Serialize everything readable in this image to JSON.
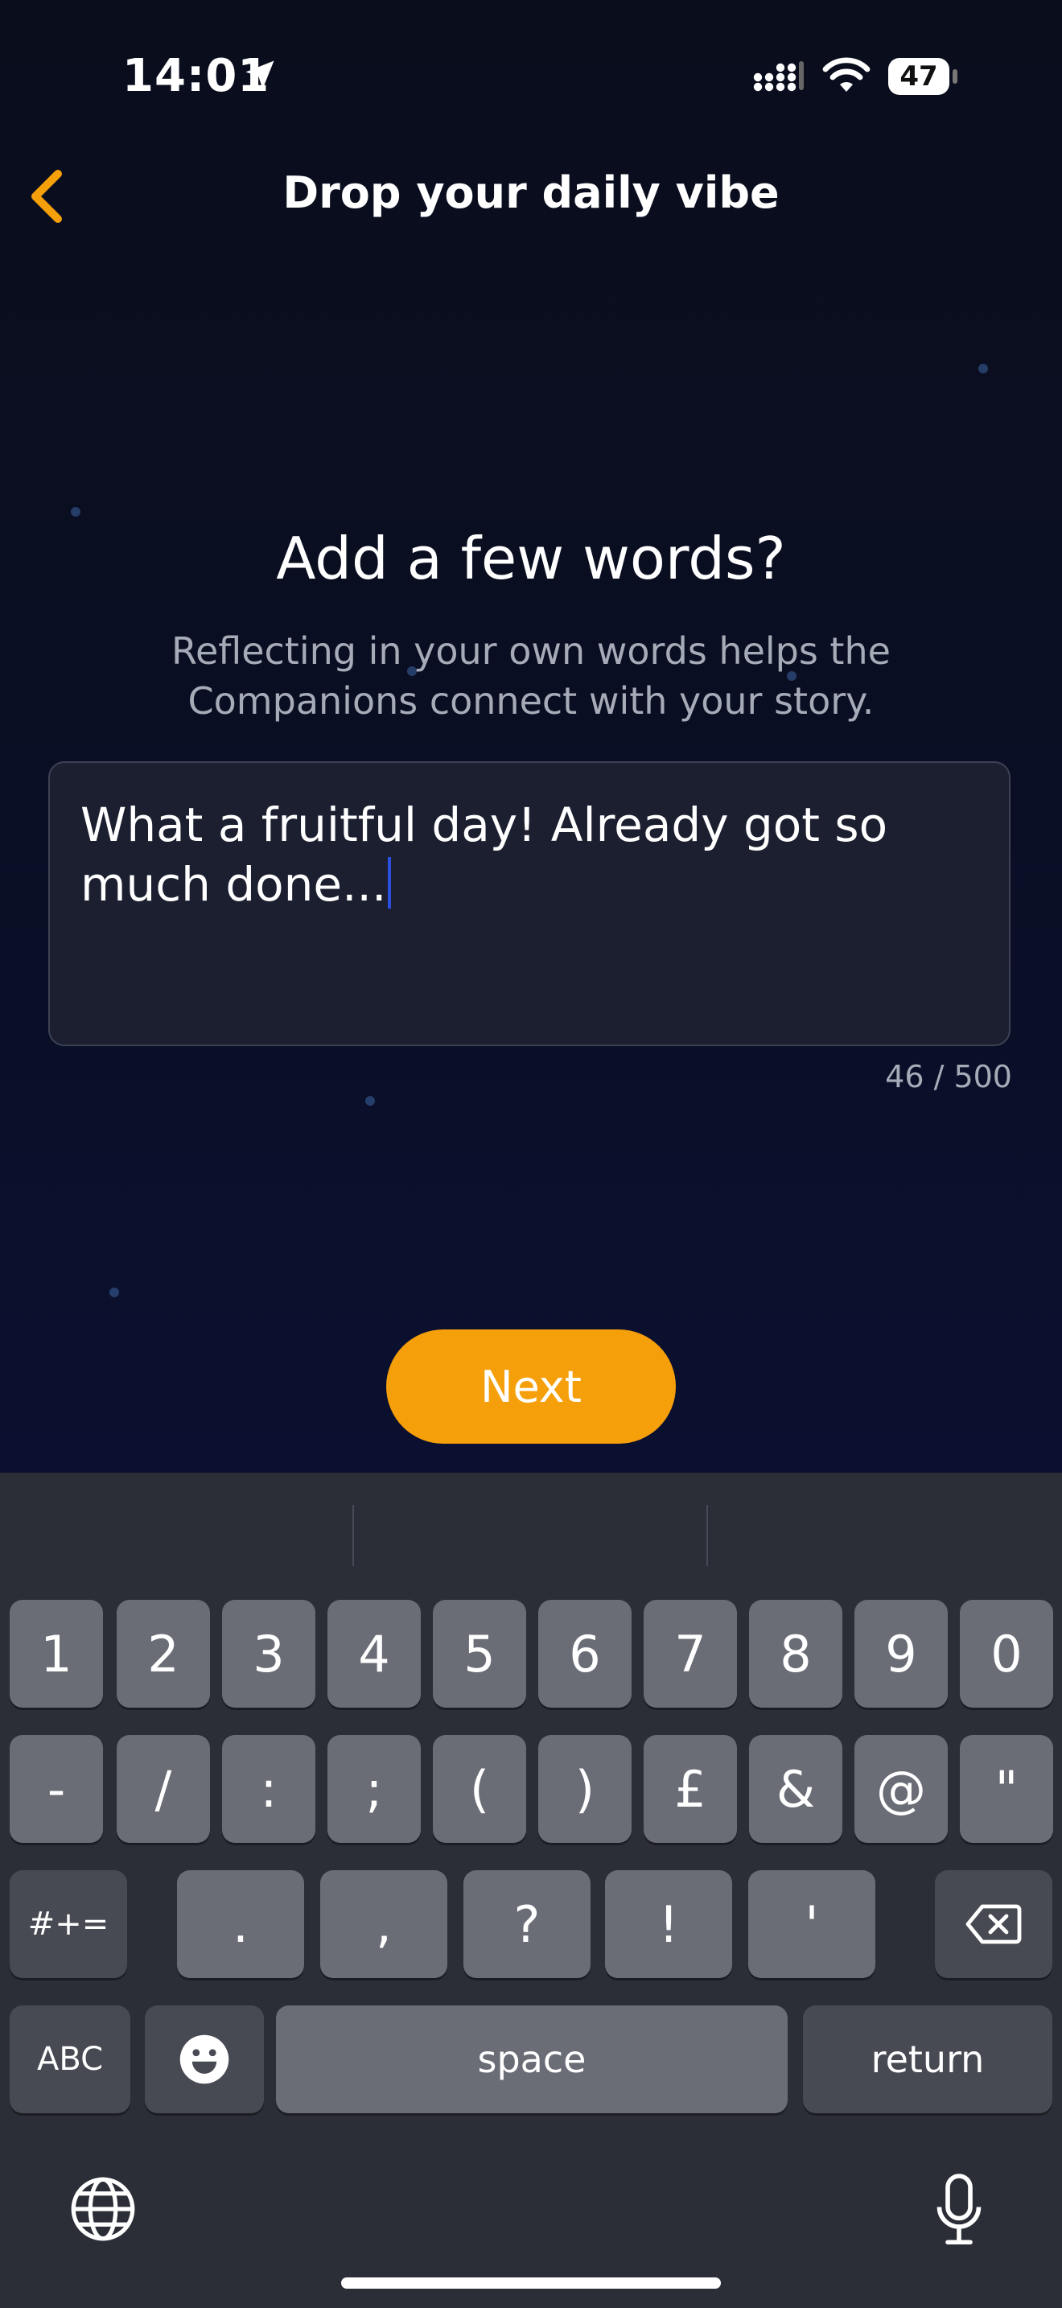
{
  "status_bar": {
    "time": "14:01",
    "battery": "47"
  },
  "nav": {
    "title": "Drop your daily vibe"
  },
  "prompt": {
    "heading": "Add a few words?",
    "subtext": "Reflecting in your own words helps the Companions connect with your story."
  },
  "entry": {
    "value": "What a fruitful day! Already got so much done...",
    "counter": "46 / 500"
  },
  "next_label": "Next",
  "colors": {
    "accent": "#f59f0a",
    "caret": "#2b50e0",
    "background": "#0b0f20"
  },
  "keyboard": {
    "row1": [
      "1",
      "2",
      "3",
      "4",
      "5",
      "6",
      "7",
      "8",
      "9",
      "0"
    ],
    "row2": [
      "-",
      "/",
      ":",
      ";",
      "(",
      ")",
      "£",
      "&",
      "@",
      "\""
    ],
    "row3": {
      "mode": "#+=",
      "keys": [
        ".",
        ",",
        "?",
        "!",
        "'"
      ]
    },
    "row4": {
      "abc": "ABC",
      "space": "space",
      "return": "return"
    }
  }
}
